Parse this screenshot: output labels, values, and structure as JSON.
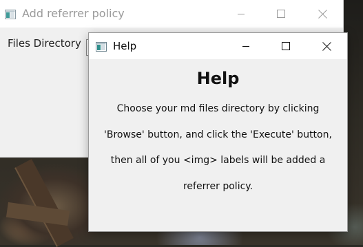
{
  "main_window": {
    "title": "Add referrer policy",
    "files_label": "Files Directory",
    "controls": {
      "minimize": "—",
      "maximize": "☐",
      "close": "✕"
    }
  },
  "help_window": {
    "title": "Help",
    "heading": "Help",
    "lines": [
      "Choose your md files directory by clicking",
      "'Browse' button, and click the 'Execute' button,",
      "then all of you <img> labels will be added a",
      "referrer policy."
    ]
  },
  "icons": {
    "app_icon": "window-app-icon",
    "minimize": "minimize-icon",
    "maximize": "maximize-icon",
    "close": "close-icon"
  }
}
